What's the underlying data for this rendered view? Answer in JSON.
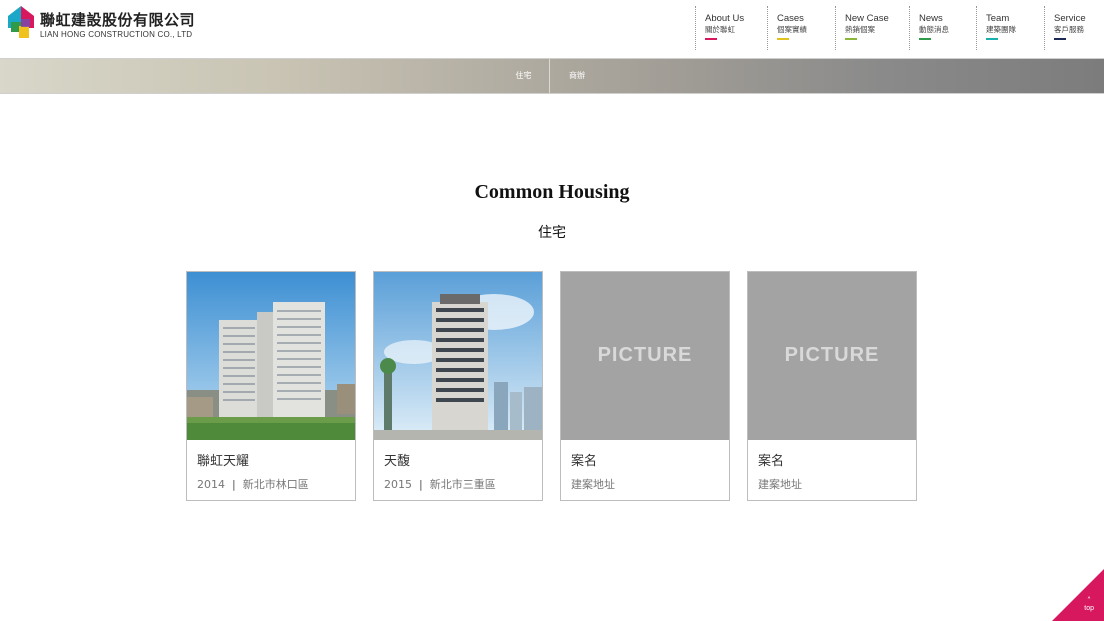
{
  "brand": {
    "name": "聯虹建設股份有限公司",
    "subtitle": "LIAN HONG CONSTRUCTION CO., LTD"
  },
  "nav": [
    {
      "en": "About Us",
      "zh": "關於聯虹",
      "color": "#d8185e"
    },
    {
      "en": "Cases",
      "zh": "個案實績",
      "color": "#e2c21c"
    },
    {
      "en": "New Case",
      "zh": "熱銷個案",
      "color": "#8bb83a"
    },
    {
      "en": "News",
      "zh": "動態消息",
      "color": "#2f9a4a"
    },
    {
      "en": "Team",
      "zh": "建築團隊",
      "color": "#1bb0b0"
    },
    {
      "en": "Service",
      "zh": "客戶服務",
      "color": "#1c2a55"
    }
  ],
  "categories": [
    {
      "label": "住宅"
    },
    {
      "label": "商辦"
    }
  ],
  "section": {
    "title_en": "Common Housing",
    "title_zh": "住宅"
  },
  "cases": [
    {
      "name": "聯虹天耀",
      "year": "2014",
      "location": "新北市林口區",
      "image": "photo"
    },
    {
      "name": "天馥",
      "year": "2015",
      "location": "新北市三重區",
      "image": "photo"
    },
    {
      "name": "案名",
      "location": "建案地址",
      "image": "placeholder",
      "placeholder_text": "PICTURE"
    },
    {
      "name": "案名",
      "location": "建案地址",
      "image": "placeholder",
      "placeholder_text": "PICTURE"
    }
  ],
  "back_to_top": {
    "label": "top",
    "color": "#d8185e",
    "arrow": "˄"
  }
}
